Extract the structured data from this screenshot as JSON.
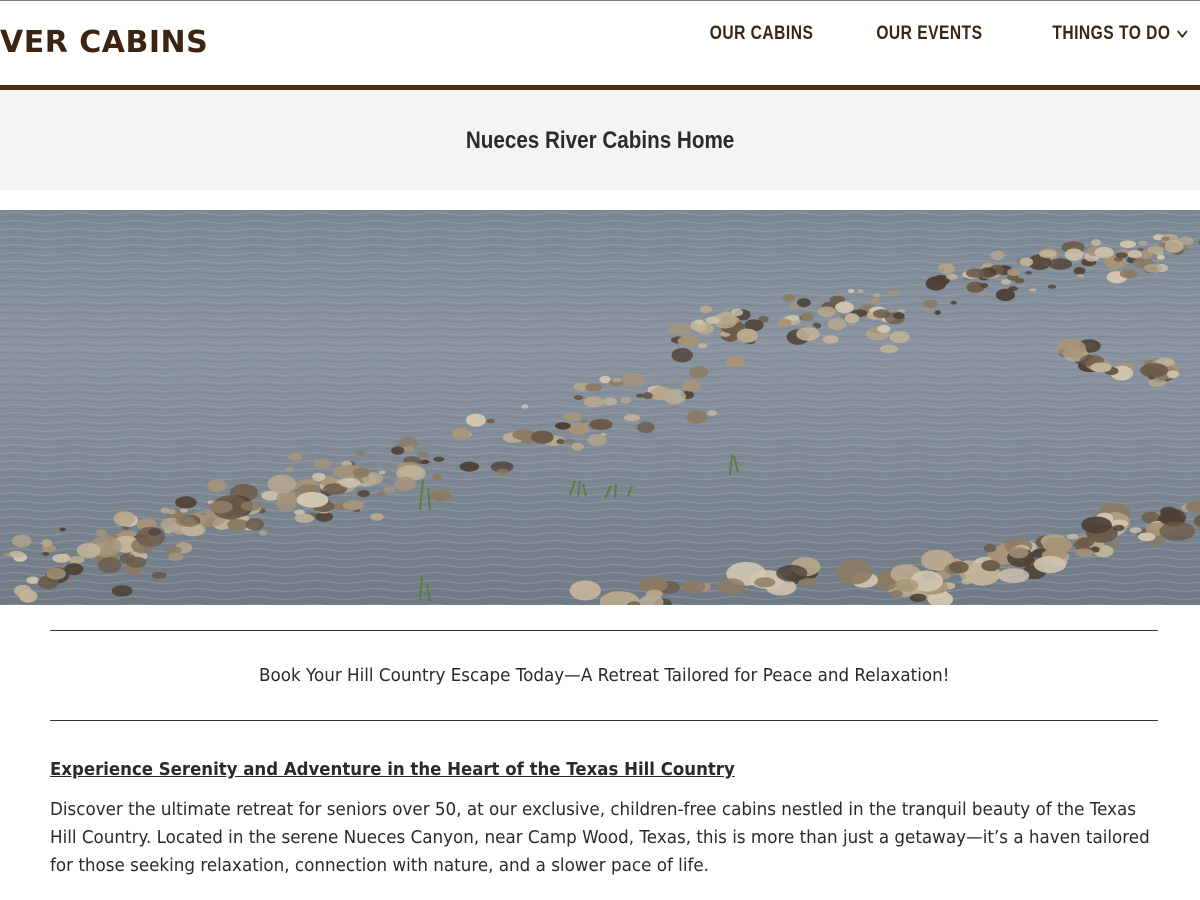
{
  "header": {
    "logo_text": "VER CABINS",
    "nav": [
      {
        "label": "OUR CABINS"
      },
      {
        "label": "OUR EVENTS"
      },
      {
        "label": "THINGS TO DO",
        "has_dropdown": true
      }
    ],
    "accent_color": "#4a2e12"
  },
  "page": {
    "title": "Nueces River Cabins Home"
  },
  "hero": {
    "image": "river-shallows-with-rocks"
  },
  "content": {
    "tagline": "Book Your Hill Country Escape Today—A Retreat Tailored for Peace and Relaxation!",
    "heading": "Experience Serenity and Adventure in the Heart of the Texas Hill Country",
    "paragraph": "Discover the ultimate retreat for seniors over 50, at our exclusive, children-free cabins nestled in the tranquil beauty of the Texas Hill Country. Located in the serene Nueces Canyon, near Camp Wood, Texas, this is more than just a getaway—it’s a haven tailored for those seeking relaxation, connection with nature, and a slower pace of life."
  }
}
